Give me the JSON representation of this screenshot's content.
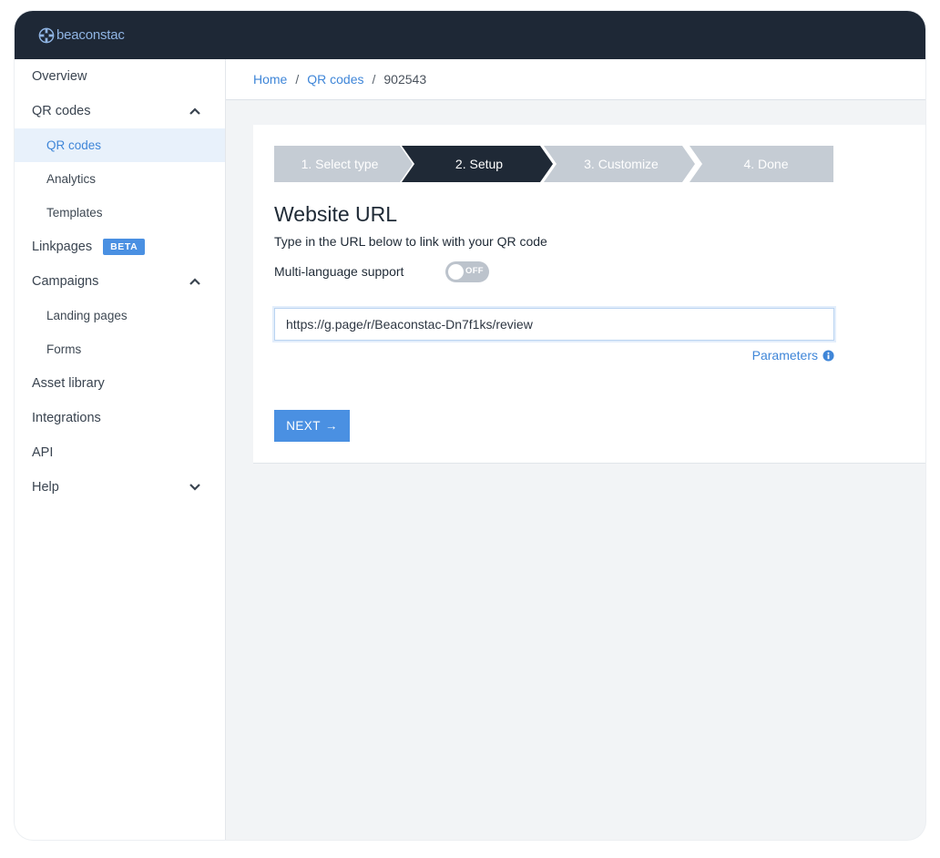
{
  "app": {
    "logo_text": "beaconstac"
  },
  "sidebar": {
    "items": [
      {
        "label": "Overview"
      },
      {
        "label": "QR codes",
        "expanded": true
      },
      {
        "label": "QR codes",
        "active": true
      },
      {
        "label": "Analytics"
      },
      {
        "label": "Templates"
      },
      {
        "label": "Linkpages",
        "badge": "BETA"
      },
      {
        "label": "Campaigns",
        "expanded": true
      },
      {
        "label": "Landing pages"
      },
      {
        "label": "Forms"
      },
      {
        "label": "Asset library"
      },
      {
        "label": "Integrations"
      },
      {
        "label": "API"
      },
      {
        "label": "Help",
        "expanded": false
      }
    ]
  },
  "breadcrumb": {
    "home": "Home",
    "section": "QR codes",
    "current": "902543",
    "separator": "/"
  },
  "wizard": {
    "steps": [
      "1. Select type",
      "2. Setup",
      "3. Customize",
      "4. Done"
    ],
    "active_step": 2
  },
  "form": {
    "title": "Website URL",
    "subtitle": "Type in the URL below to link with your QR code",
    "multilang_label": "Multi-language support",
    "toggle_state": "OFF",
    "url_value": "https://g.page/r/Beaconstac-Dn7f1ks/review",
    "parameters_label": "Parameters",
    "next_label": "NEXT",
    "next_arrow": "→"
  },
  "colors": {
    "topbar": "#1e2836",
    "accent": "#4a90e2",
    "step_active": "#1f2936",
    "step_inactive": "#c5ccd4"
  }
}
